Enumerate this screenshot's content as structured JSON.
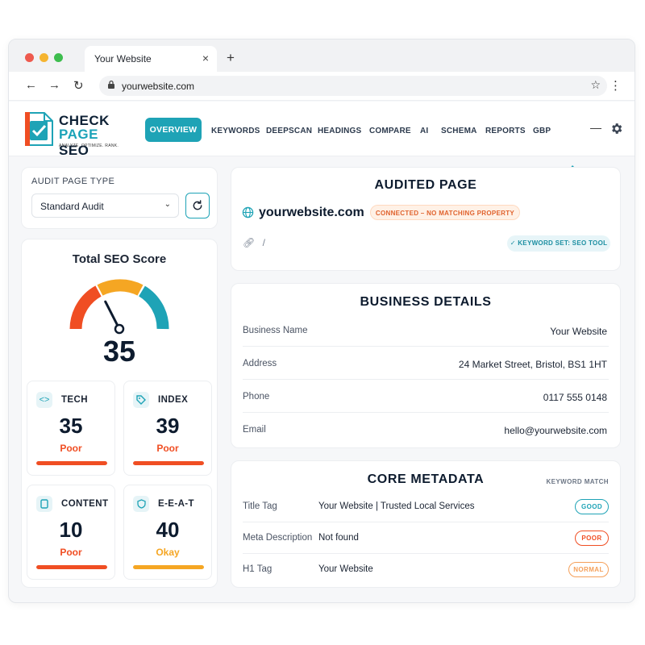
{
  "browser": {
    "tab_title": "Your Website",
    "tab_close": "×",
    "new_tab": "+",
    "url": "yourwebsite.com",
    "back": "←",
    "forward": "→",
    "reload": "↻",
    "star": "☆",
    "menu": "⋮",
    "traffic_colors": [
      "#ee5a4e",
      "#f5b430",
      "#3dbd4e"
    ]
  },
  "app": {
    "logo_check": "CHECK",
    "logo_page": "PAGE",
    "logo_seo": "SEO",
    "logo_tagline": "ANALYZE. OPTIMIZE. RANK.",
    "nav": [
      "OVERVIEW",
      "KEYWORDS",
      "DEEPSCAN",
      "HEADINGS",
      "COMPARE",
      "AI",
      "SCHEMA",
      "REPORTS",
      "GBP"
    ],
    "active_nav": "OVERVIEW",
    "minimize": "—",
    "accent": "#1ea3b6"
  },
  "sidebar": {
    "audit_type_label": "AUDIT PAGE TYPE",
    "audit_type_value": "Standard Audit",
    "score_title": "Total SEO Score",
    "score_value": "35",
    "score_fraction": 0.35,
    "cards": [
      {
        "label": "TECH",
        "value": "35",
        "status": "Poor",
        "status_color": "#f04e23",
        "fill": 1.0,
        "icon": "code-icon",
        "glyph": "<>"
      },
      {
        "label": "INDEX",
        "value": "39",
        "status": "Poor",
        "status_color": "#f04e23",
        "fill": 1.0,
        "icon": "tag-icon",
        "glyph": "⌂"
      },
      {
        "label": "CONTENT",
        "value": "10",
        "status": "Poor",
        "status_color": "#f04e23",
        "fill": 1.0,
        "icon": "document-icon",
        "glyph": "▯"
      },
      {
        "label": "E-E-A-T",
        "value": "40",
        "status": "Okay",
        "status_color": "#f5a623",
        "fill": 1.0,
        "icon": "shield-icon",
        "glyph": "◇"
      }
    ]
  },
  "audited": {
    "title": "AUDITED PAGE",
    "domain": "yourwebsite.com",
    "connection": "CONNECTED – NO MATCHING PROPERTY",
    "path": "/",
    "keyword_set": "✓ KEYWORD SET: SEO TOOL"
  },
  "business": {
    "title": "BUSINESS DETAILS",
    "rows": [
      {
        "label": "Business Name",
        "value": "Your Website"
      },
      {
        "label": "Address",
        "value": "24 Market Street, Bristol, BS1 1HT"
      },
      {
        "label": "Phone",
        "value": "0117 555 0148"
      },
      {
        "label": "Email",
        "value": "hello@yourwebsite.com"
      }
    ]
  },
  "metadata": {
    "title": "CORE METADATA",
    "column_header": "KEYWORD MATCH",
    "rows": [
      {
        "label": "Title Tag",
        "value": "Your Website | Trusted Local Services",
        "badge": "GOOD",
        "badge_color": "#1ea3b6"
      },
      {
        "label": "Meta Description",
        "value": "Not found",
        "badge": "POOR",
        "badge_color": "#f04e23"
      },
      {
        "label": "H1 Tag",
        "value": "Your Website",
        "badge": "NORMAL",
        "badge_color": "#f5a05a"
      }
    ]
  }
}
